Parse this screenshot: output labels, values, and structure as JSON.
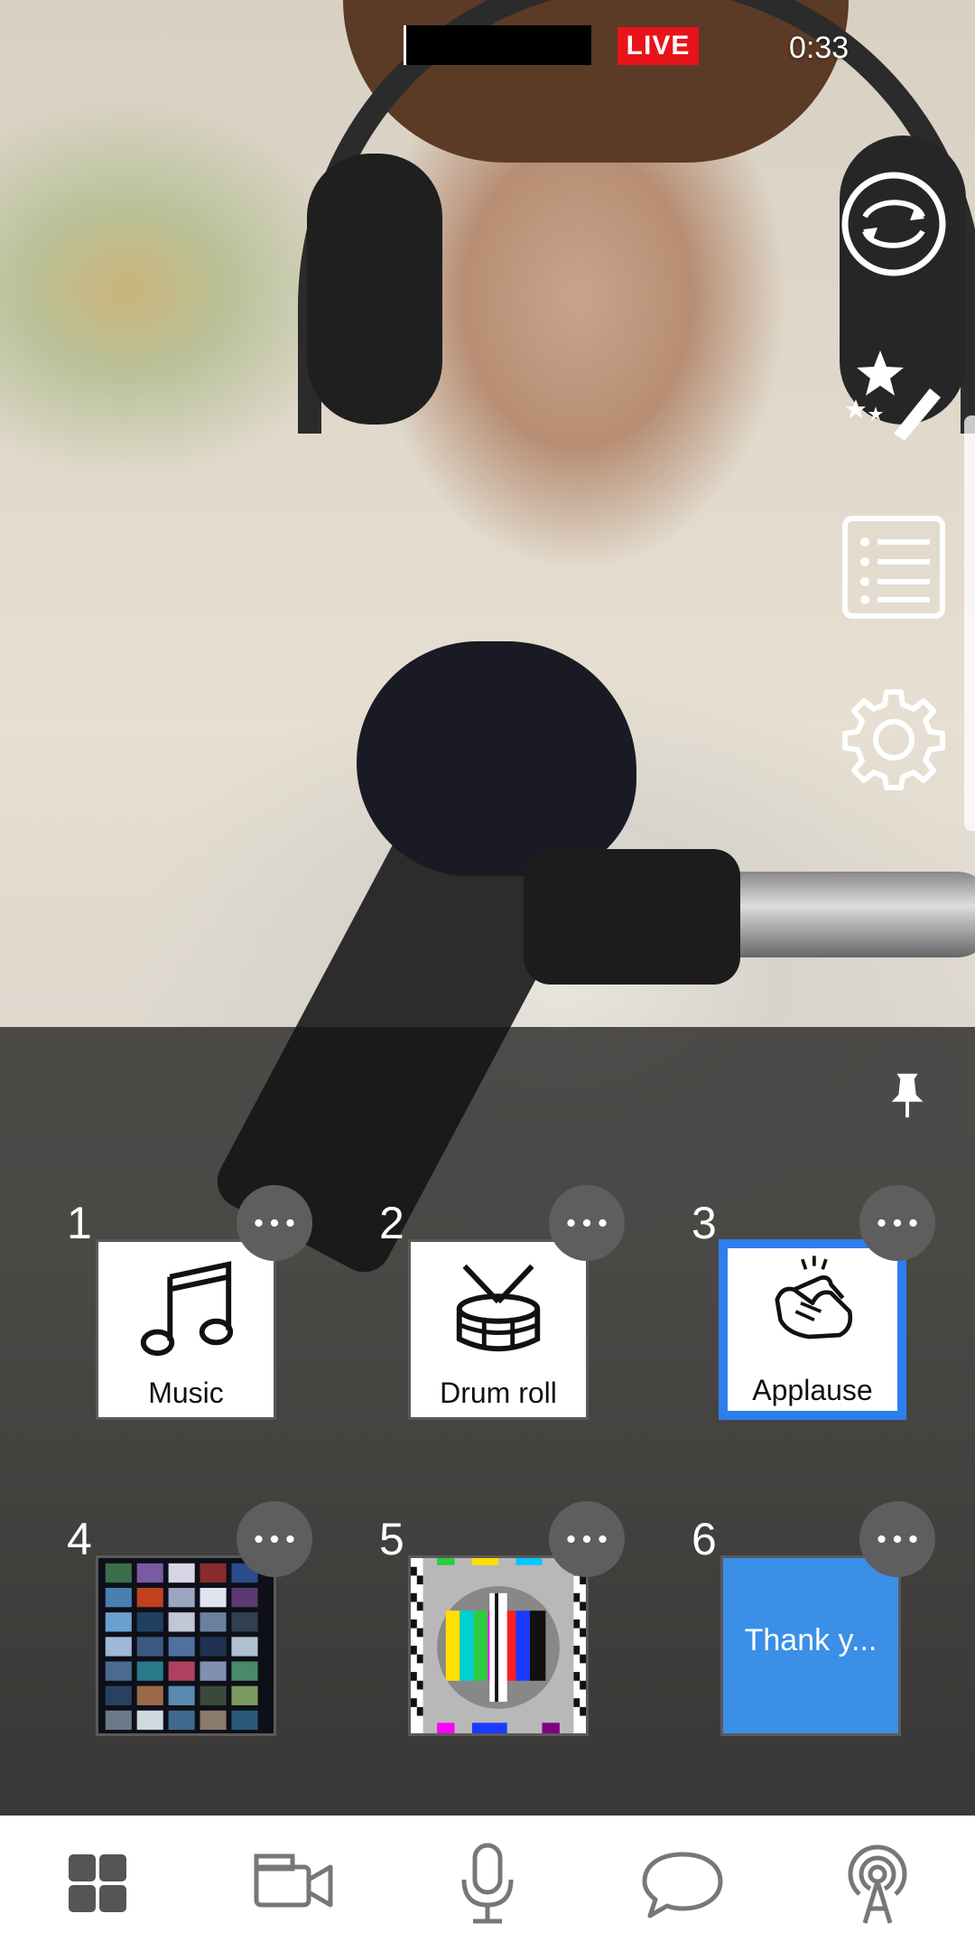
{
  "header": {
    "live_label": "LIVE",
    "timer": "0:33"
  },
  "right_rail": {
    "icons": [
      "switch-camera-icon",
      "effects-icon",
      "playlist-icon",
      "settings-icon"
    ]
  },
  "tiles": [
    {
      "number": "1",
      "label": "Music",
      "icon": "music-note-icon",
      "selected": false
    },
    {
      "number": "2",
      "label": "Drum roll",
      "icon": "drum-icon",
      "selected": false
    },
    {
      "number": "3",
      "label": "Applause",
      "icon": "clapping-hands-icon",
      "selected": true
    },
    {
      "number": "4",
      "label": "",
      "icon": "video-grid-thumbnail",
      "selected": false
    },
    {
      "number": "5",
      "label": "",
      "icon": "test-pattern-thumbnail",
      "selected": false
    },
    {
      "number": "6",
      "label": "Thank y...",
      "icon": "title-card-thumbnail",
      "selected": false,
      "color": "#3b8fe6"
    }
  ],
  "bottom_nav": [
    "scenes-icon",
    "camera-icon",
    "microphone-icon",
    "chat-icon",
    "broadcast-icon"
  ],
  "colors": {
    "live": "#e8141b",
    "selected": "#2d7ff0"
  }
}
